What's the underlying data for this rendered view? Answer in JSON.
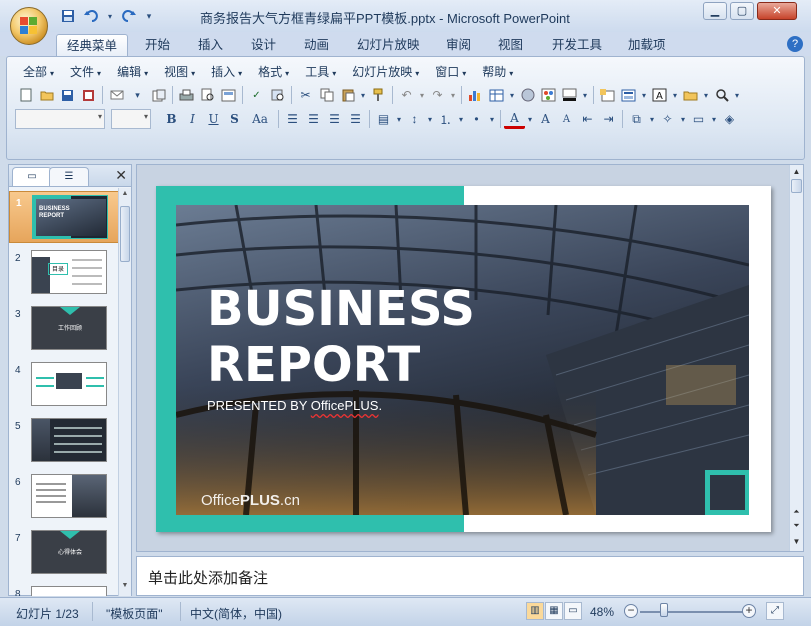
{
  "window": {
    "title": "商务报告大气方框青绿扁平PPT模板.pptx - Microsoft PowerPoint",
    "minimize": "▁",
    "maximize": "▢",
    "close": "✕"
  },
  "qat": [
    "💾",
    "↶",
    "↷",
    "▾"
  ],
  "ribbon_tabs": [
    "经典菜单",
    "开始",
    "插入",
    "设计",
    "动画",
    "幻灯片放映",
    "审阅",
    "视图",
    "开发工具",
    "加载项"
  ],
  "ribbon_active_tab": "经典菜单",
  "classic_menus": [
    "全部",
    "文件",
    "编辑",
    "视图",
    "插入",
    "格式",
    "工具",
    "幻灯片放映",
    "窗口",
    "帮助"
  ],
  "format_buttons": [
    "B",
    "I",
    "U",
    "S",
    "Aa"
  ],
  "slide_pane": {
    "thumbnails": [
      {
        "num": "1",
        "label": "BUSINESS REPORT"
      },
      {
        "num": "2",
        "label": "目录"
      },
      {
        "num": "3",
        "label": "工作回顾"
      },
      {
        "num": "4",
        "label": ""
      },
      {
        "num": "5",
        "label": ""
      },
      {
        "num": "6",
        "label": ""
      },
      {
        "num": "7",
        "label": "心得体会"
      },
      {
        "num": "8",
        "label": ""
      }
    ],
    "selected": 1
  },
  "slide": {
    "title_line1": "BUSINESS",
    "title_line2": "REPORT",
    "presented_prefix": "PRESENTED BY ",
    "presented_brand": "OfficePLUS",
    "presented_suffix": ".",
    "footer_logo_regular": "Office",
    "footer_logo_bold": "PLUS",
    "footer_logo_suffix": ".cn",
    "accent_color": "#2fbfad"
  },
  "notes": {
    "placeholder": "单击此处添加备注"
  },
  "status": {
    "slide_counter": "幻灯片 1/23",
    "template": "\"模板页面\"",
    "language": "中文(简体，中国)",
    "zoom": "48%",
    "zoom_level": 0.48
  }
}
